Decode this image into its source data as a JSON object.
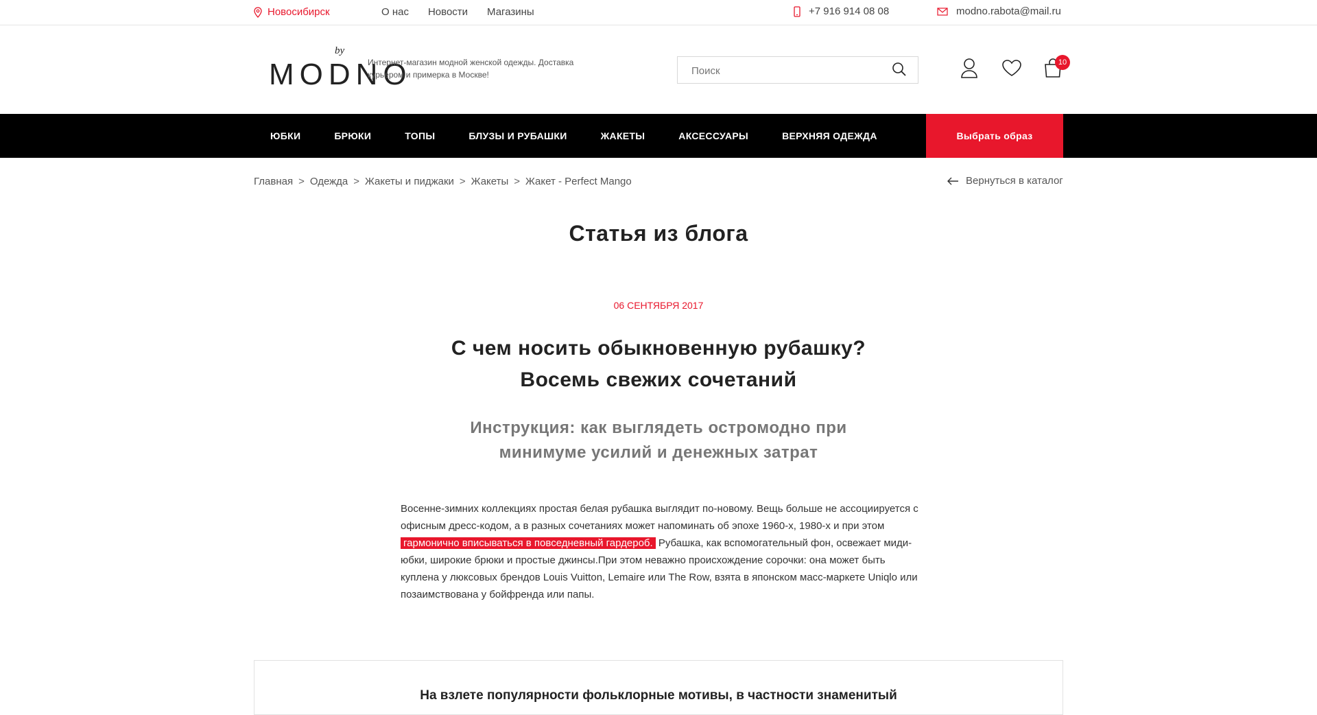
{
  "topbar": {
    "city": "Новосибирск",
    "links": [
      "О нас",
      "Новости",
      "Магазины"
    ],
    "phone": "+7 916 914 08 08",
    "email": "modno.rabota@mail.ru"
  },
  "header": {
    "logo_by": "by",
    "logo_word": "MODNO",
    "tagline": "Интернет-магазин модной женской одежды. Доставка курьером и примерка в Москве!",
    "search_placeholder": "Поиск",
    "cart_count": "10"
  },
  "nav": {
    "items": [
      "Юбки",
      "Брюки",
      "Топы",
      "Блузы и рубашки",
      "Жакеты",
      "Аксессуары",
      "Верхняя одежда"
    ],
    "cta": "Выбрать образ"
  },
  "breadcrumb": {
    "items": [
      "Главная",
      "Одежда",
      "Жакеты и пиджаки",
      "Жакеты",
      "Жакет - Perfect Mango"
    ],
    "separator": ">",
    "back": "Вернуться в каталог"
  },
  "page": {
    "title": "Статья из блога"
  },
  "article": {
    "date": "06 сентября 2017",
    "title_line1": "С чем носить обыкновенную рубашку?",
    "title_line2": "Восемь свежих сочетаний",
    "subtitle_line1": "Инструкция: как выглядеть остромодно при",
    "subtitle_line2": "минимуме усилий и денежных затрат",
    "para_part1": "Восенне-зимних коллекциях простая белая рубашка выглядит по-новому. Вещь больше не ассоциируется с офисным дресс-кодом, а в разных сочетаниях может напоминать об эпохе 1960-х, 1980-х и при этом ",
    "para_highlight": "гармонично вписываться в повседневный гардероб.",
    "para_part2": " Рубашка, как вспомогательный фон, освежает миди-юбки, широкие брюки и простые джинсы.При этом неважно происхождение сорочки: она может быть куплена у люксовых брендов Louis Vuitton, Lemaire или The Row, взята в японском масс-маркете Uniqlo или позаимствована у бойфренда или папы.",
    "quote_start": "На взлете популярности фольклорные мотивы, в частности знаменитый"
  },
  "colors": {
    "accent": "#e8172c",
    "nav_bg": "#000000"
  }
}
